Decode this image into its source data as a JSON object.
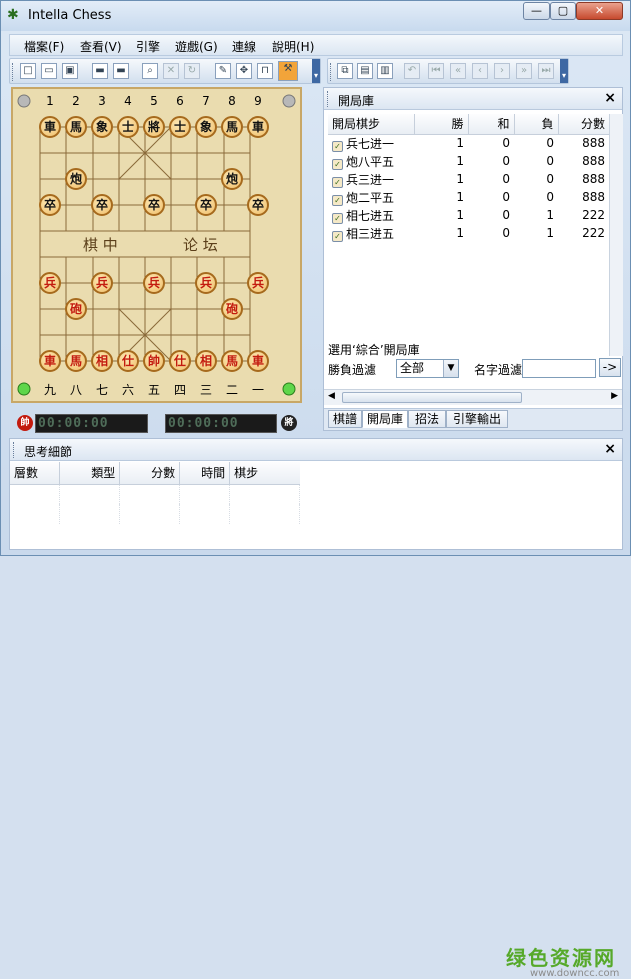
{
  "window": {
    "title": "Intella Chess",
    "min": "—",
    "max": "▢",
    "close": "✕"
  },
  "menu": [
    "檔案(F)",
    "查看(V)",
    "引擎",
    "遊戲(G)",
    "連線",
    "說明(H)"
  ],
  "board": {
    "files_top": [
      "1",
      "2",
      "3",
      "4",
      "5",
      "6",
      "7",
      "8",
      "9"
    ],
    "files_bottom": [
      "九",
      "八",
      "七",
      "六",
      "五",
      "四",
      "三",
      "二",
      "一"
    ],
    "river_left": "棋 中",
    "river_right": "论 坛",
    "black_back": [
      "車",
      "馬",
      "象",
      "士",
      "將",
      "士",
      "象",
      "馬",
      "車"
    ],
    "black_cannon": "炮",
    "black_pawn": "卒",
    "red_back": [
      "車",
      "馬",
      "相",
      "仕",
      "帥",
      "仕",
      "相",
      "馬",
      "車"
    ],
    "red_cannon": "砲",
    "red_pawn": "兵"
  },
  "clock": {
    "red_badge": "帥",
    "black_badge": "將",
    "red_time": "00:00:00",
    "black_time": "00:00:00"
  },
  "openings": {
    "title": "開局庫",
    "columns": [
      "開局棋步",
      "勝",
      "和",
      "負",
      "分數"
    ],
    "rows": [
      [
        "兵七进一",
        "1",
        "0",
        "0",
        "888"
      ],
      [
        "炮八平五",
        "1",
        "0",
        "0",
        "888"
      ],
      [
        "兵三进一",
        "1",
        "0",
        "0",
        "888"
      ],
      [
        "炮二平五",
        "1",
        "0",
        "0",
        "888"
      ],
      [
        "相七进五",
        "1",
        "0",
        "1",
        "222"
      ],
      [
        "相三进五",
        "1",
        "0",
        "1",
        "222"
      ]
    ],
    "selected_label": "選用‘綜合’開局庫",
    "result_filter_label": "勝負過濾",
    "result_filter_value": "全部",
    "name_filter_label": "名字過濾",
    "go": "->"
  },
  "tabs": [
    "棋譜",
    "開局庫",
    "招法",
    "引擎輸出"
  ],
  "think": {
    "title": "思考細節",
    "columns": [
      "層數",
      "類型",
      "分數",
      "時間",
      "棋步"
    ]
  },
  "watermark": {
    "cn": "绿色资源网",
    "url": "www.downcc.com"
  }
}
